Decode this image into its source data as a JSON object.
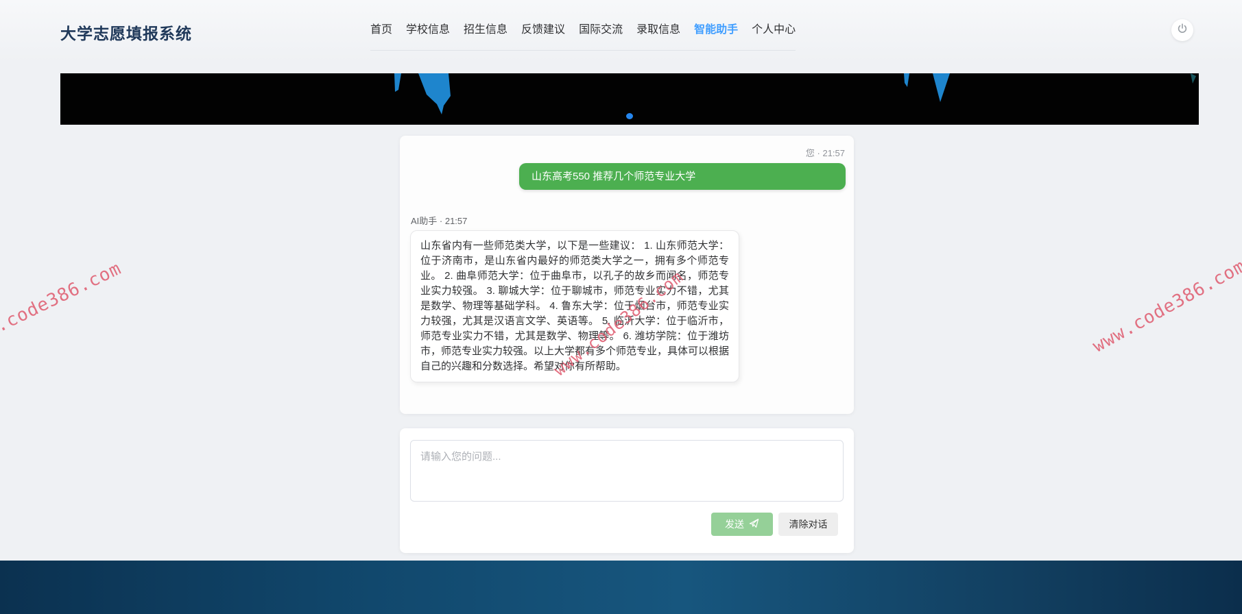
{
  "app": {
    "title": "大学志愿填报系统"
  },
  "nav": {
    "items": [
      {
        "label": "首页",
        "active": false
      },
      {
        "label": "学校信息",
        "active": false
      },
      {
        "label": "招生信息",
        "active": false
      },
      {
        "label": "反馈建议",
        "active": false
      },
      {
        "label": "国际交流",
        "active": false
      },
      {
        "label": "录取信息",
        "active": false
      },
      {
        "label": "智能助手",
        "active": true
      },
      {
        "label": "个人中心",
        "active": false
      }
    ]
  },
  "header": {
    "logout_icon": "power-icon"
  },
  "banner": {
    "indicator_color": "#2586ee",
    "background": "#020202",
    "shape_color": "#1e85cd"
  },
  "chat": {
    "user_message": {
      "sender": "您",
      "time": "21:57",
      "meta": "您 · 21:57",
      "text": "山东高考550 推荐几个师范专业大学",
      "bubble_color": "#4caf50"
    },
    "ai_message": {
      "sender": "AI助手",
      "time": "21:57",
      "meta": "AI助手 · 21:57",
      "text": "山东省内有一些师范类大学，以下是一些建议： 1. 山东师范大学：位于济南市，是山东省内最好的师范类大学之一，拥有多个师范专业。 2. 曲阜师范大学：位于曲阜市，以孔子的故乡而闻名，师范专业实力较强。 3. 聊城大学：位于聊城市，师范专业实力不错，尤其是数学、物理等基础学科。 4. 鲁东大学：位于烟台市，师范专业实力较强，尤其是汉语言文学、英语等。 5. 临沂大学：位于临沂市，师范专业实力不错，尤其是数学、物理等。 6. 潍坊学院：位于潍坊市，师范专业实力较强。以上大学都有多个师范专业，具体可以根据自己的兴趣和分数选择。希望对你有所帮助。"
    }
  },
  "composer": {
    "placeholder": "请输入您的问题...",
    "send_label": "发送",
    "send_icon": "paper-plane-icon",
    "clear_label": "清除对话"
  },
  "watermark": {
    "text": "www.code386.com",
    "color": "#df5a6e"
  },
  "colors": {
    "accent": "#409eff",
    "title": "#20395a",
    "footer_dark": "#0b3150",
    "footer_light": "#17567e"
  }
}
